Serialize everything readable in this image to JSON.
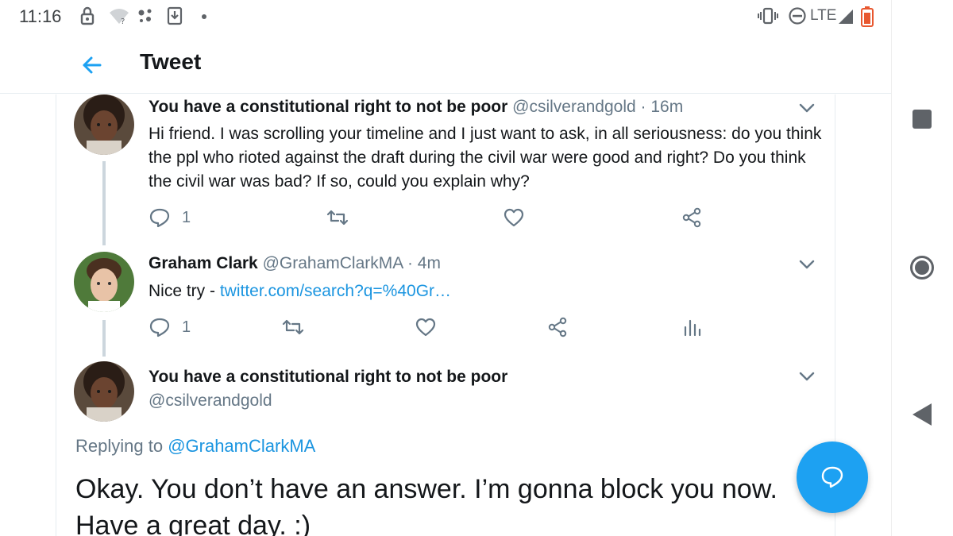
{
  "status_bar": {
    "time": "11:16",
    "network": "LTE",
    "icons": [
      "lock-icon",
      "wifi-question-icon",
      "assistant-dots-icon",
      "download-icon",
      "notification-dot-icon",
      "vibrate-icon",
      "dnd-icon",
      "signal-icon",
      "battery-icon"
    ]
  },
  "app_bar": {
    "title": "Tweet",
    "back_icon": "arrow-left-icon",
    "accent": "#1da1f2"
  },
  "tweets": [
    {
      "name": "You have a constitutional right to not be poor",
      "handle": "@csilverandgold",
      "separator": "·",
      "time": "16m",
      "text": "Hi friend. I was scrolling your timeline and I just want to ask, in all seriousness: do you think the ppl who rioted against the draft during the civil war were good and right? Do you think the civil war was bad? If so, could you explain why?",
      "reply_count": "1"
    },
    {
      "name": "Graham Clark",
      "handle": "@GrahamClarkMA",
      "separator": "·",
      "time": "4m",
      "text_prefix": "Nice try - ",
      "link": "twitter.com/search?q=%40Gr…",
      "reply_count": "1"
    }
  ],
  "main_tweet": {
    "name": "You have a constitutional right to not be poor",
    "handle": "@csilverandgold",
    "replying_prefix": "Replying to ",
    "replying_handle": "@GrahamClarkMA",
    "text": "Okay. You don’t have an answer. I’m gonna block you now. Have a great day. :)"
  },
  "colors": {
    "link": "#1b95e0",
    "secondary_text": "#657786",
    "fab": "#1da1f2"
  }
}
